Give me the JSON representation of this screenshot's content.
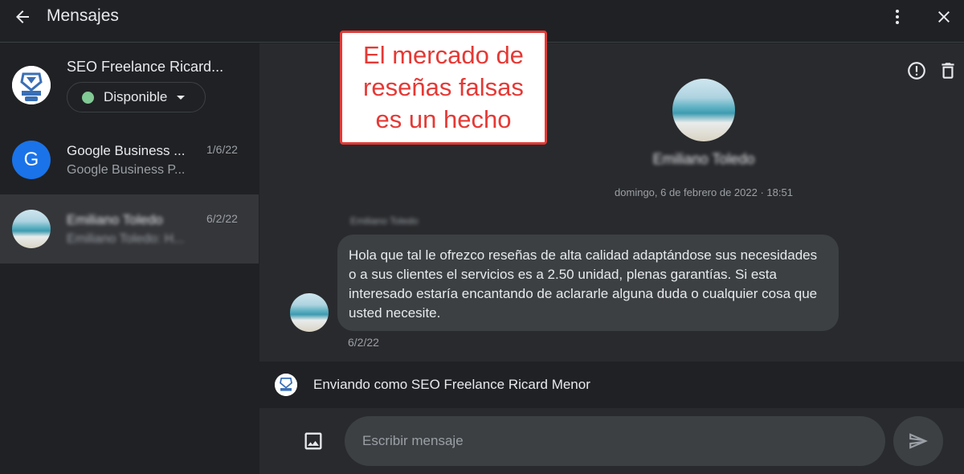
{
  "header": {
    "title": "Mensajes"
  },
  "account": {
    "name": "SEO Freelance Ricard...",
    "logo_text": "SOLID SEO",
    "status": "Disponible",
    "status_color": "#81c995"
  },
  "conversations": [
    {
      "title": "Google Business ...",
      "subtitle": "Google Business P...",
      "date": "1/6/22",
      "avatar_letter": "G",
      "avatar_color": "#1a73e8"
    },
    {
      "title": "Emiliano Toledo",
      "subtitle": "Emiliano Toledo: H...",
      "date": "6/2/22"
    }
  ],
  "chat": {
    "contact_name": "Emiliano Toledo",
    "date": "domingo, 6 de febrero de 2022 · 18:51",
    "sender_name": "Emiliano Toledo",
    "message": "Hola que tal le ofrezco reseñas de alta calidad adaptándose sus necesidades o a sus clientes el servicios  es a 2.50 unidad, plenas garantías. Si esta interesado estaría encantando  de aclararle alguna duda o cualquier cosa que usted necesite.",
    "message_time": "6/2/22"
  },
  "sending_as": "Enviando como SEO Freelance Ricard Menor",
  "composer": {
    "placeholder": "Escribir mensaje"
  },
  "annotation": {
    "lines": [
      "El mercado de",
      "reseñas falsas",
      "es un hecho"
    ],
    "color": "#e53935"
  },
  "icons": [
    "arrow-back-icon",
    "more-vert-icon",
    "close-icon",
    "report-icon",
    "delete-icon",
    "image-icon",
    "send-icon"
  ]
}
